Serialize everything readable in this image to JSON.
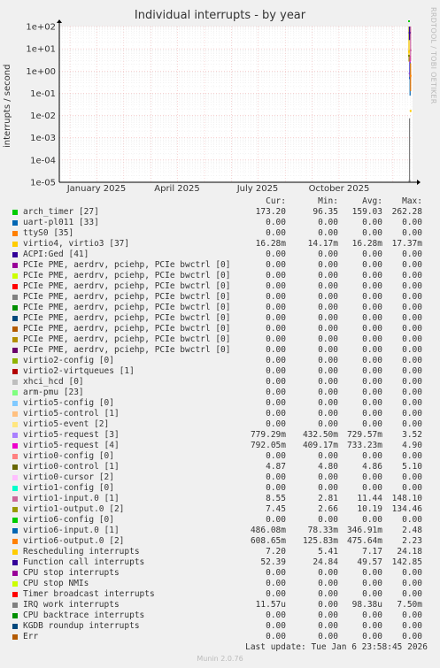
{
  "title": "Individual interrupts - by year",
  "side_label": "RRDTOOL / TOBI OETIKER",
  "footer": {
    "last_update": "Last update: Tue Jan  6 23:58:45 2026",
    "version": "Munin 2.0.76"
  },
  "legend_headers": {
    "cur": "Cur:",
    "min": "Min:",
    "avg": "Avg:",
    "max": "Max:"
  },
  "chart_data": {
    "type": "line",
    "title": "Individual interrupts - by year",
    "ylabel": "interrupts / second",
    "y_scale": "log",
    "ylim": [
      1e-05,
      100
    ],
    "y_ticks": [
      "1e+02",
      "1e+01",
      "1e+00",
      "1e-01",
      "1e-02",
      "1e-03",
      "1e-04",
      "1e-05"
    ],
    "x_ticks": [
      "January 2025",
      "April 2025",
      "July 2025",
      "October 2025"
    ],
    "grid": true,
    "series": [
      {
        "name": "arch_timer [27]",
        "color": "#00cc00",
        "cur": "173.20",
        "min": "96.35",
        "avg": "159.03",
        "max": "262.28"
      },
      {
        "name": "uart-pl011 [33]",
        "color": "#0066b3",
        "cur": "0.00",
        "min": "0.00",
        "avg": "0.00",
        "max": "0.00"
      },
      {
        "name": "ttyS0 [35]",
        "color": "#ff8000",
        "cur": "0.00",
        "min": "0.00",
        "avg": "0.00",
        "max": "0.00"
      },
      {
        "name": "virtio4, virtio3 [37]",
        "color": "#ffcc00",
        "cur": "16.28m",
        "min": "14.17m",
        "avg": "16.28m",
        "max": "17.37m"
      },
      {
        "name": "ACPI:Ged [41]",
        "color": "#330099",
        "cur": "0.00",
        "min": "0.00",
        "avg": "0.00",
        "max": "0.00"
      },
      {
        "name": "PCIe PME, aerdrv, pciehp, PCIe bwctrl [0]",
        "color": "#990099",
        "cur": "0.00",
        "min": "0.00",
        "avg": "0.00",
        "max": "0.00"
      },
      {
        "name": "PCIe PME, aerdrv, pciehp, PCIe bwctrl [0]",
        "color": "#ccff00",
        "cur": "0.00",
        "min": "0.00",
        "avg": "0.00",
        "max": "0.00"
      },
      {
        "name": "PCIe PME, aerdrv, pciehp, PCIe bwctrl [0]",
        "color": "#ff0000",
        "cur": "0.00",
        "min": "0.00",
        "avg": "0.00",
        "max": "0.00"
      },
      {
        "name": "PCIe PME, aerdrv, pciehp, PCIe bwctrl [0]",
        "color": "#808080",
        "cur": "0.00",
        "min": "0.00",
        "avg": "0.00",
        "max": "0.00"
      },
      {
        "name": "PCIe PME, aerdrv, pciehp, PCIe bwctrl [0]",
        "color": "#008f00",
        "cur": "0.00",
        "min": "0.00",
        "avg": "0.00",
        "max": "0.00"
      },
      {
        "name": "PCIe PME, aerdrv, pciehp, PCIe bwctrl [0]",
        "color": "#00487d",
        "cur": "0.00",
        "min": "0.00",
        "avg": "0.00",
        "max": "0.00"
      },
      {
        "name": "PCIe PME, aerdrv, pciehp, PCIe bwctrl [0]",
        "color": "#b35a00",
        "cur": "0.00",
        "min": "0.00",
        "avg": "0.00",
        "max": "0.00"
      },
      {
        "name": "PCIe PME, aerdrv, pciehp, PCIe bwctrl [0]",
        "color": "#b38f00",
        "cur": "0.00",
        "min": "0.00",
        "avg": "0.00",
        "max": "0.00"
      },
      {
        "name": "PCIe PME, aerdrv, pciehp, PCIe bwctrl [0]",
        "color": "#6b006b",
        "cur": "0.00",
        "min": "0.00",
        "avg": "0.00",
        "max": "0.00"
      },
      {
        "name": "virtio2-config [0]",
        "color": "#8fb300",
        "cur": "0.00",
        "min": "0.00",
        "avg": "0.00",
        "max": "0.00"
      },
      {
        "name": "virtio2-virtqueues [1]",
        "color": "#b30000",
        "cur": "0.00",
        "min": "0.00",
        "avg": "0.00",
        "max": "0.00"
      },
      {
        "name": "xhci_hcd [0]",
        "color": "#bebebe",
        "cur": "0.00",
        "min": "0.00",
        "avg": "0.00",
        "max": "0.00"
      },
      {
        "name": "arm-pmu [23]",
        "color": "#80ff80",
        "cur": "0.00",
        "min": "0.00",
        "avg": "0.00",
        "max": "0.00"
      },
      {
        "name": "virtio5-config [0]",
        "color": "#80c9ff",
        "cur": "0.00",
        "min": "0.00",
        "avg": "0.00",
        "max": "0.00"
      },
      {
        "name": "virtio5-control [1]",
        "color": "#ffc080",
        "cur": "0.00",
        "min": "0.00",
        "avg": "0.00",
        "max": "0.00"
      },
      {
        "name": "virtio5-event [2]",
        "color": "#ffe680",
        "cur": "0.00",
        "min": "0.00",
        "avg": "0.00",
        "max": "0.00"
      },
      {
        "name": "virtio5-request [3]",
        "color": "#aa80ff",
        "cur": "779.29m",
        "min": "432.50m",
        "avg": "729.57m",
        "max": "3.52"
      },
      {
        "name": "virtio5-request [4]",
        "color": "#ee00cc",
        "cur": "792.05m",
        "min": "409.17m",
        "avg": "733.23m",
        "max": "4.90"
      },
      {
        "name": "virtio0-config [0]",
        "color": "#ff8080",
        "cur": "0.00",
        "min": "0.00",
        "avg": "0.00",
        "max": "0.00"
      },
      {
        "name": "virtio0-control [1]",
        "color": "#666600",
        "cur": "4.87",
        "min": "4.80",
        "avg": "4.86",
        "max": "5.10"
      },
      {
        "name": "virtio0-cursor [2]",
        "color": "#ffbfff",
        "cur": "0.00",
        "min": "0.00",
        "avg": "0.00",
        "max": "0.00"
      },
      {
        "name": "virtio1-config [0]",
        "color": "#00ffcc",
        "cur": "0.00",
        "min": "0.00",
        "avg": "0.00",
        "max": "0.00"
      },
      {
        "name": "virtio1-input.0 [1]",
        "color": "#cc6699",
        "cur": "8.55",
        "min": "2.81",
        "avg": "11.44",
        "max": "148.10"
      },
      {
        "name": "virtio1-output.0 [2]",
        "color": "#999900",
        "cur": "7.45",
        "min": "2.66",
        "avg": "10.19",
        "max": "134.46"
      },
      {
        "name": "virtio6-config [0]",
        "color": "#00cc00",
        "cur": "0.00",
        "min": "0.00",
        "avg": "0.00",
        "max": "0.00"
      },
      {
        "name": "virtio6-input.0 [1]",
        "color": "#0066b3",
        "cur": "486.08m",
        "min": "78.33m",
        "avg": "346.91m",
        "max": "2.48"
      },
      {
        "name": "virtio6-output.0 [2]",
        "color": "#ff8000",
        "cur": "608.65m",
        "min": "125.83m",
        "avg": "475.64m",
        "max": "2.23"
      },
      {
        "name": "Rescheduling interrupts",
        "color": "#ffcc00",
        "cur": "7.20",
        "min": "5.41",
        "avg": "7.17",
        "max": "24.18"
      },
      {
        "name": "Function call interrupts",
        "color": "#330099",
        "cur": "52.39",
        "min": "24.84",
        "avg": "49.57",
        "max": "142.85"
      },
      {
        "name": "CPU stop interrupts",
        "color": "#990099",
        "cur": "0.00",
        "min": "0.00",
        "avg": "0.00",
        "max": "0.00"
      },
      {
        "name": "CPU stop NMIs",
        "color": "#ccff00",
        "cur": "0.00",
        "min": "0.00",
        "avg": "0.00",
        "max": "0.00"
      },
      {
        "name": "Timer broadcast interrupts",
        "color": "#ff0000",
        "cur": "0.00",
        "min": "0.00",
        "avg": "0.00",
        "max": "0.00"
      },
      {
        "name": "IRQ work interrupts",
        "color": "#808080",
        "cur": "11.57u",
        "min": "0.00",
        "avg": "98.38u",
        "max": "7.50m"
      },
      {
        "name": "CPU backtrace interrupts",
        "color": "#008f00",
        "cur": "0.00",
        "min": "0.00",
        "avg": "0.00",
        "max": "0.00"
      },
      {
        "name": "KGDB roundup interrupts",
        "color": "#00487d",
        "cur": "0.00",
        "min": "0.00",
        "avg": "0.00",
        "max": "0.00"
      },
      {
        "name": "Err",
        "color": "#b35a00",
        "cur": "0.00",
        "min": "0.00",
        "avg": "0.00",
        "max": "0.00"
      }
    ]
  }
}
